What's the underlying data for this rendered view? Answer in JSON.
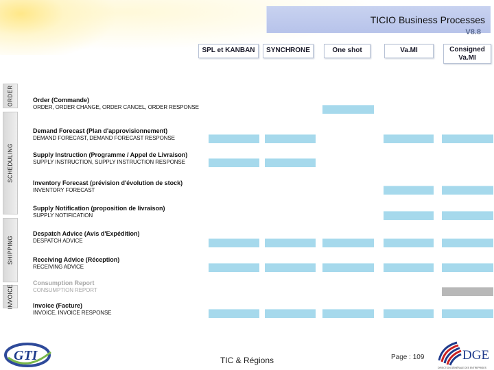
{
  "header": {
    "title": "TICIO Business Processes",
    "title_peek": "V8.8"
  },
  "columns": [
    "SPL et KANBAN",
    "SYNCHRONE",
    "One shot",
    "Va.MI",
    "Consigned Va.MI"
  ],
  "sections": [
    "ORDER",
    "SCHEDULING",
    "SHIPPING",
    "INVOICE"
  ],
  "rows": [
    {
      "title": "Order (Commande)",
      "subtitle": "ORDER, ORDER CHANGE, ORDER CANCEL, ORDER RESPONSE",
      "faded": false,
      "cells": [
        false,
        false,
        true,
        false,
        false
      ],
      "gray": false
    },
    {
      "title": "Demand Forecast  (Plan d'approvisionnement)",
      "subtitle": "DEMAND FORECAST, DEMAND FORECAST RESPONSE",
      "faded": false,
      "cells": [
        true,
        true,
        false,
        true,
        true
      ],
      "gray": false
    },
    {
      "title": "Supply Instruction (Programme / Appel de Livraison)",
      "subtitle": "SUPPLY INSTRUCTION, SUPPLY INSTRUCTION RESPONSE",
      "faded": false,
      "cells": [
        true,
        true,
        false,
        false,
        false
      ],
      "gray": false
    },
    {
      "title": "Inventory Forecast  (prévision d'évolution de stock)",
      "subtitle": "INVENTORY FORECAST",
      "faded": false,
      "cells": [
        false,
        false,
        false,
        true,
        true
      ],
      "gray": false
    },
    {
      "title": "Supply Notification (proposition de livraison)",
      "subtitle": "SUPPLY NOTIFICATION",
      "faded": false,
      "cells": [
        false,
        false,
        false,
        true,
        true
      ],
      "gray": false
    },
    {
      "title": "Despatch Advice (Avis d'Expédition)",
      "subtitle": "DESPATCH ADVICE",
      "faded": false,
      "cells": [
        true,
        true,
        true,
        true,
        true
      ],
      "gray": false
    },
    {
      "title": "Receiving Advice (Réception)",
      "subtitle": "RECEIVING ADVICE",
      "faded": false,
      "cells": [
        true,
        true,
        true,
        true,
        true
      ],
      "gray": false
    },
    {
      "title": "Consumption Report",
      "subtitle": "CONSUMPTION REPORT",
      "faded": true,
      "cells": [
        false,
        false,
        false,
        false,
        true
      ],
      "gray": true
    },
    {
      "title": "Invoice (Facture)",
      "subtitle": "INVOICE, INVOICE RESPONSE",
      "faded": false,
      "cells": [
        true,
        true,
        true,
        true,
        true
      ],
      "gray": false
    }
  ],
  "footer": {
    "left_logo": "GTI",
    "center_text": "TIC & Régions",
    "page": "Page : 109",
    "right_logo": "DGE",
    "right_logo_tagline": "DIRECTION GÉNÉRALE DES ENTREPRISES"
  },
  "colors": {
    "cell": "#a6d9ec",
    "cell_gray": "#b8b8b8",
    "title_bar": "#c0cbee",
    "dge_blue": "#1f3b8c",
    "dge_red": "#cc2222"
  }
}
